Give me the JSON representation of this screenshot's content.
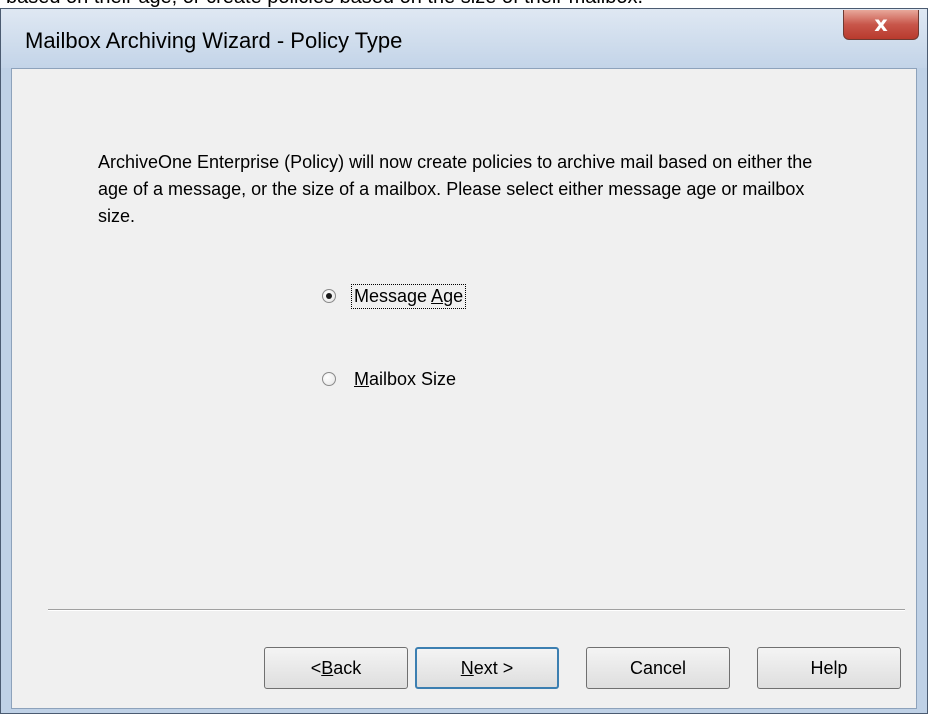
{
  "page_top_text": "based on their age, or create policies based on the size of their mailbox.",
  "window": {
    "title": "Mailbox Archiving Wizard - Policy Type",
    "close_glyph": "x"
  },
  "content": {
    "intro_text": "ArchiveOne Enterprise (Policy) will now create policies to archive mail based on either the age of a message, or the size of a mailbox. Please select either message age or mailbox size."
  },
  "policy_type": {
    "options": [
      {
        "label_pre": "Message ",
        "label_mnemonic": "A",
        "label_post": "ge",
        "selected": true,
        "focused": true
      },
      {
        "label_pre": "",
        "label_mnemonic": "M",
        "label_post": "ailbox Size",
        "selected": false,
        "focused": false
      }
    ]
  },
  "buttons": {
    "back": {
      "pre": "< ",
      "mnemonic": "B",
      "post": "ack"
    },
    "next": {
      "pre": "",
      "mnemonic": "N",
      "post": "ext >"
    },
    "cancel": "Cancel",
    "help": "Help"
  },
  "colors": {
    "titlebar": "#c3d4e8",
    "client_bg": "#f0f0f0",
    "close_button": "#c8564a",
    "default_button_border": "#3c7fb1"
  },
  "icons": {
    "close": "close-icon",
    "radio": "radio-icon"
  }
}
